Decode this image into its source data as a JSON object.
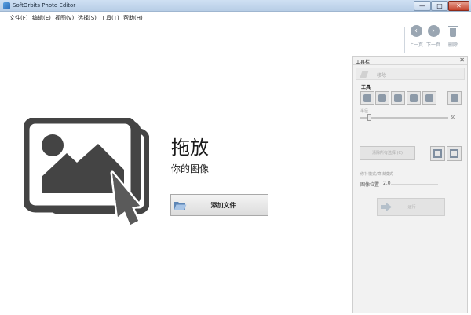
{
  "window": {
    "title": "SoftOrbits Photo Editor",
    "minimize": "—",
    "maximize": "□",
    "close": "✕"
  },
  "menu": {
    "items": [
      "文件(F)",
      "编辑(E)",
      "视图(V)",
      "选择(S)",
      "工具(T)",
      "帮助(H)"
    ]
  },
  "toolbar": {
    "prev_label": "上一页",
    "next_label": "下一页",
    "delete_label": "删除",
    "prev_icon": "arrow-left-icon",
    "next_icon": "arrow-right-icon",
    "delete_icon": "trash-icon"
  },
  "drop_area": {
    "title": "拖放",
    "subtitle": "你的图像",
    "add_button": "添加文件",
    "icon": "image-stack-cursor-icon"
  },
  "panel": {
    "title": "工具栏",
    "close": "✕",
    "section": "移除",
    "tools_label": "工具",
    "tools": [
      "pencil-icon",
      "brush-icon",
      "rectangle-select-icon",
      "lasso-icon",
      "magic-wand-icon",
      "stamp-icon"
    ],
    "brush_label": "半径",
    "brush_value": "50",
    "brush_level": 0.1,
    "clear_button": "清除所有选择 (C)",
    "options_label": "修补模式/算法模式",
    "position_label": "图像位置",
    "position_value": "2.0",
    "run_button": "运行"
  },
  "colors": {
    "icon_gray": "#444444",
    "cursor_gray": "#5a5a5a",
    "panel_bg": "#f2f2f2",
    "title_bar": "#c3d6ec"
  }
}
